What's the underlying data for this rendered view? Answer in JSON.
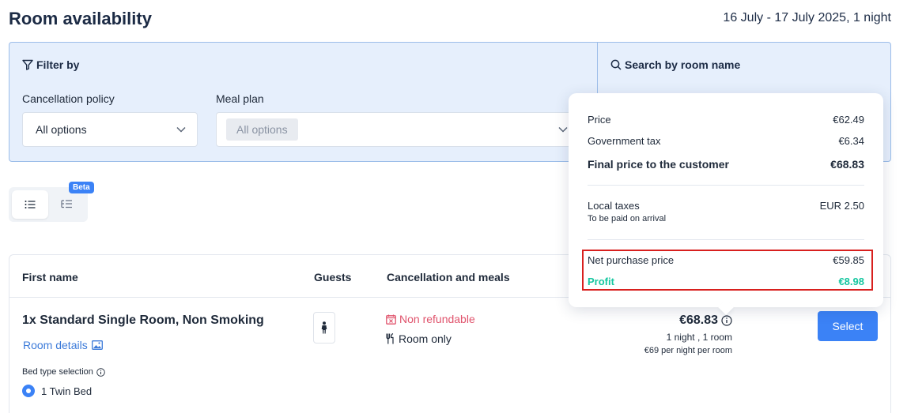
{
  "header": {
    "title": "Room availability",
    "date_range": "16 July - 17 July 2025, 1 night"
  },
  "filters": {
    "filter_heading": "Filter by",
    "search_heading": "Search by room name",
    "cancellation_label": "Cancellation policy",
    "cancellation_value": "All options",
    "meal_label": "Meal plan",
    "meal_value": "All options"
  },
  "view_toggle": {
    "beta_label": "Beta"
  },
  "table": {
    "columns": [
      "First name",
      "Guests",
      "Cancellation and meals"
    ],
    "row": {
      "room_name": "1x Standard Single Room, Non Smoking",
      "room_details": "Room details",
      "bed_type_label": "Bed type selection",
      "bed_option": "1 Twin Bed",
      "cancellation": "Non refundable",
      "meal": "Room only",
      "price": "€68.83",
      "price_sub": "1 night , 1 room",
      "price_per_night": "€69 per night per room",
      "select_label": "Select"
    }
  },
  "price_breakdown": {
    "price_label": "Price",
    "price_value": "€62.49",
    "tax_label": "Government tax",
    "tax_value": "€6.34",
    "final_label": "Final price to the customer",
    "final_value": "€68.83",
    "local_label": "Local taxes",
    "local_value": "EUR 2.50",
    "local_note": "To be paid on arrival",
    "net_label": "Net purchase price",
    "net_value": "€59.85",
    "profit_label": "Profit",
    "profit_value": "€8.98"
  },
  "colors": {
    "accent": "#3b82f6",
    "filter_bg": "#e6effc",
    "non_refundable": "#e0536c",
    "profit": "#16c7a0",
    "highlight": "#d8201e"
  }
}
